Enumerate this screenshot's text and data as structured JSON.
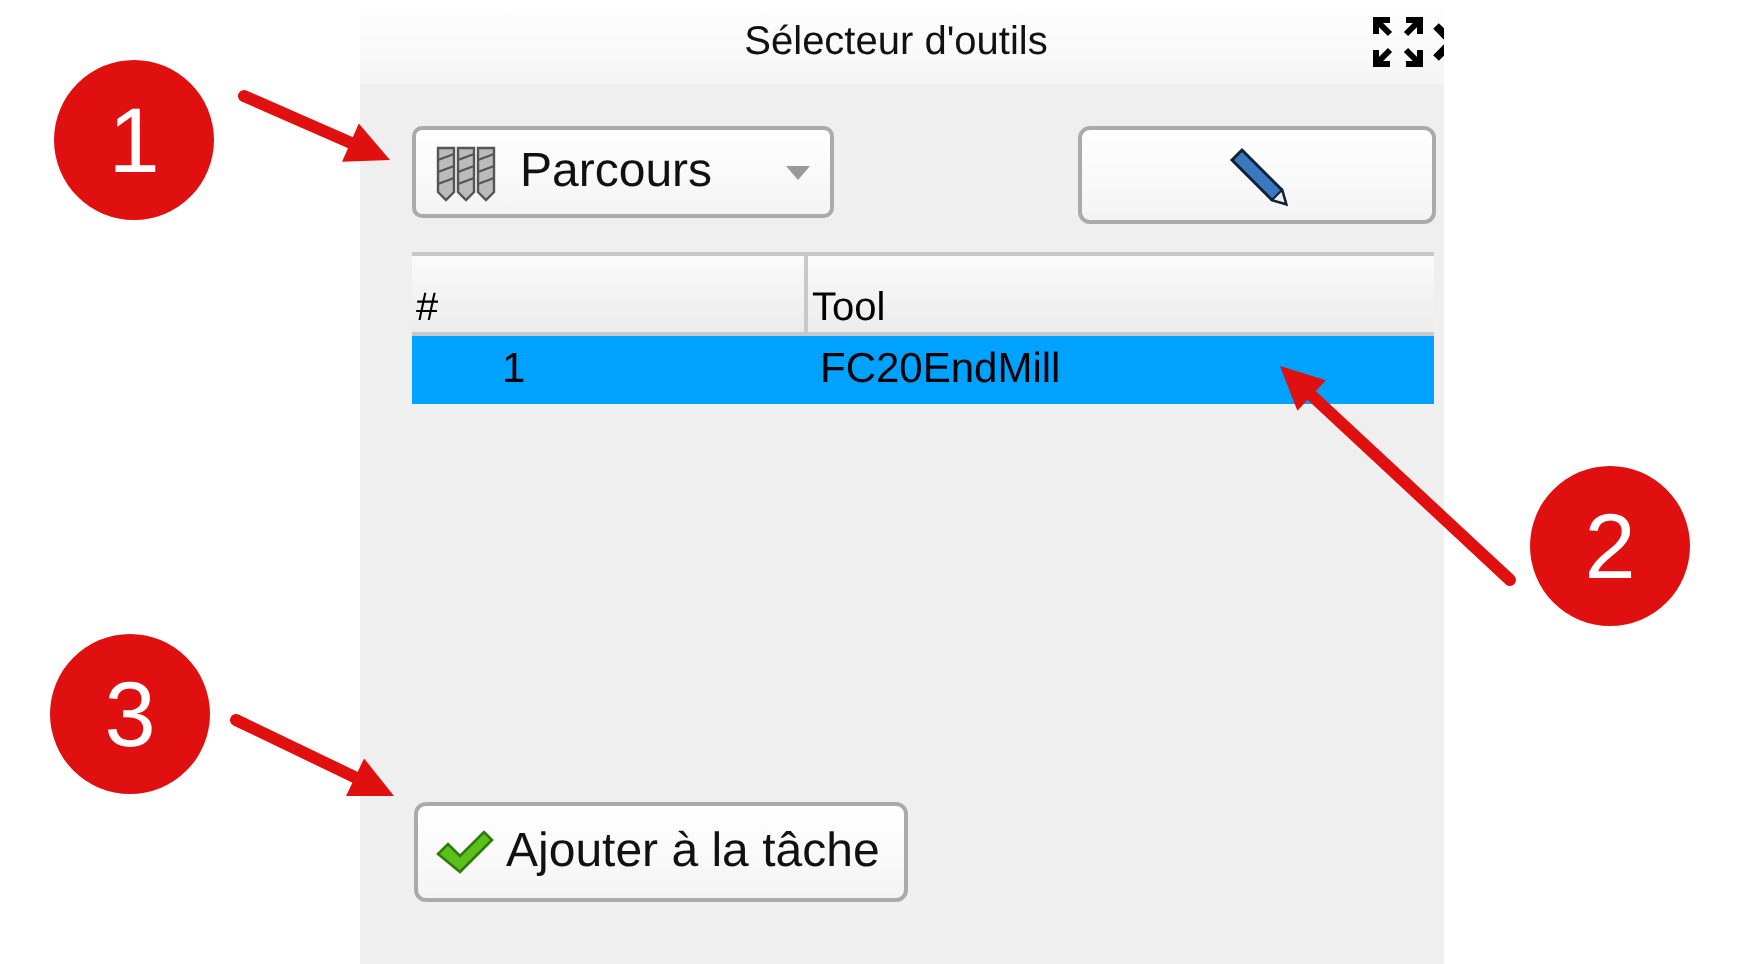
{
  "window": {
    "title": "Sélecteur d'outils"
  },
  "dropdown": {
    "value": "Parcours"
  },
  "table": {
    "columns": [
      "#",
      "Tool"
    ],
    "rows": [
      {
        "cells": [
          "1",
          "FC20EndMill"
        ],
        "selected": true
      }
    ]
  },
  "buttons": [
    {
      "label": "Ajouter à la tâche"
    }
  ],
  "annotations": [
    {
      "label": "1"
    },
    {
      "label": "2"
    },
    {
      "label": "3"
    }
  ]
}
